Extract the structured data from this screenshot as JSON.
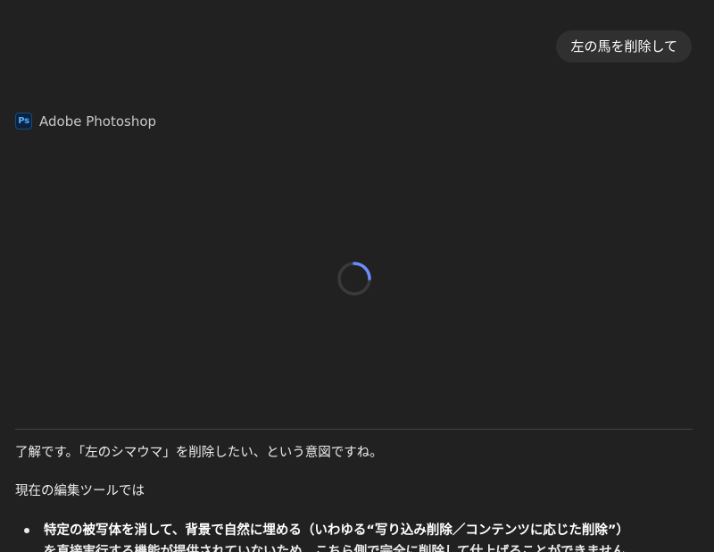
{
  "user_message": "左の馬を削除して",
  "app": {
    "icon_label": "Ps",
    "name": "Adobe Photoshop",
    "state": "loading"
  },
  "reply": {
    "paragraph_1": "了解です。「左のシマウマ」を削除したい、という意図ですね。",
    "paragraph_2": "現在の編集ツールでは",
    "bullets": [
      "特定の被写体を消して、背景で自然に埋める（いわゆる“写り込み削除／コンテンツに応じた削除”）",
      "を直接実行する機能が提供されていないため、こちら側で完全に削除して仕上げることができません。"
    ]
  },
  "colors": {
    "background": "#212121",
    "bubble": "#303030",
    "spinner_track": "#3a3a3a",
    "spinner_arc": "#6b8cff",
    "ps_icon_fg": "#4fb0ff",
    "ps_icon_bg": "#0b2340"
  }
}
